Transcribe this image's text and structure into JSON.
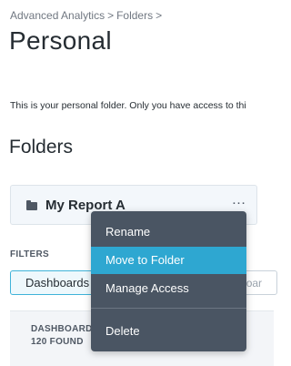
{
  "breadcrumb": {
    "items": [
      "Advanced Analytics",
      "Folders"
    ],
    "separator": ">"
  },
  "page": {
    "title": "Personal",
    "description": "This is your personal folder. Only you have access to thi"
  },
  "folders": {
    "heading": "Folders",
    "items": [
      {
        "name": "My Report A",
        "icon": "folder-icon",
        "more_label": "…"
      }
    ]
  },
  "context_menu": {
    "items": [
      {
        "label": "Rename",
        "active": false
      },
      {
        "label": "Move to Folder",
        "active": true
      },
      {
        "label": "Manage Access",
        "active": false
      },
      {
        "label": "Delete",
        "active": false
      }
    ]
  },
  "filters": {
    "label": "FILTERS",
    "selected": "Dashboards",
    "search_placeholder": "Dashboar"
  },
  "results": {
    "heading": "DASHBOARDS",
    "count": "120 FOUND"
  },
  "colors": {
    "accent": "#2ea7d1",
    "menu_bg": "#4a5563",
    "text": "#262d33"
  }
}
